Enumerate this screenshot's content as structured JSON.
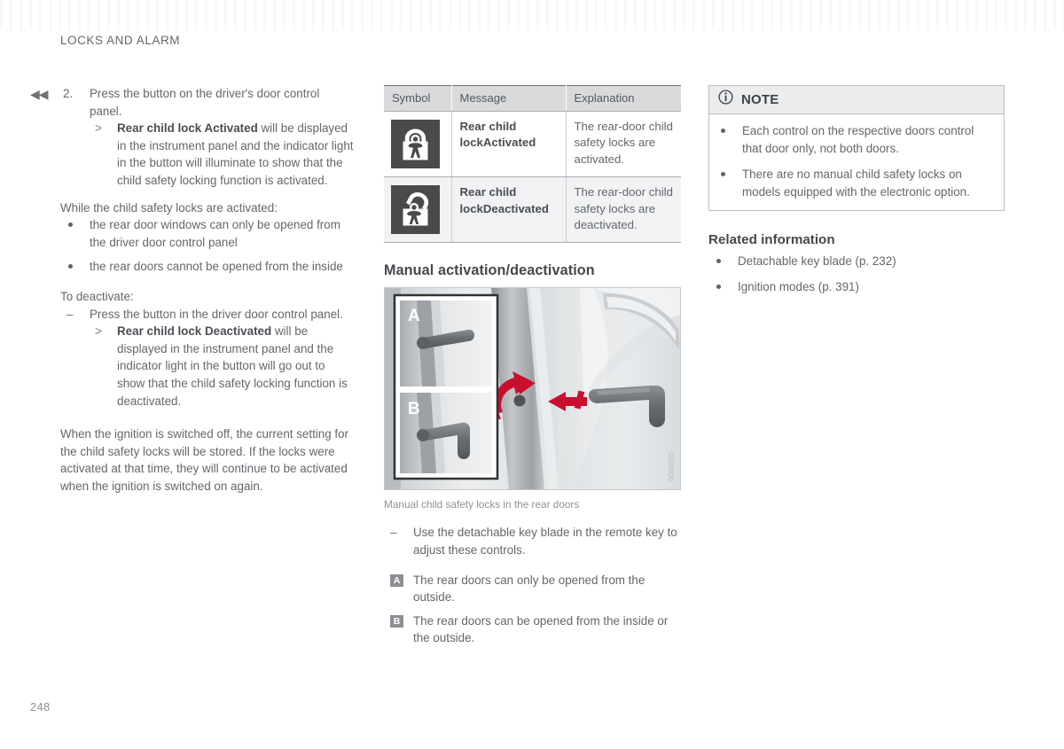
{
  "document": {
    "running_header": "LOCKS AND ALARM",
    "page_number": "248",
    "continuation_marker": "◀◀"
  },
  "left_column": {
    "step": {
      "number": "2.",
      "text": "Press the button on the driver's door control panel.",
      "results": [
        {
          "marker": ">",
          "bold": "Rear child lock Activated",
          "rest": " will be displayed in the instrument panel and the indicator light in the button will illuminate to show that the child safety locking function is activated."
        }
      ]
    },
    "intro_activated": "While the child safety locks are activated:",
    "activated_bullets": [
      "the rear door windows can only be opened from the driver door control panel",
      "the rear doors cannot be opened from the inside"
    ],
    "deactivate_heading": "To deactivate:",
    "deactivate_step": {
      "marker": "–",
      "text": "Press the button in the driver door control panel."
    },
    "deactivate_results": [
      {
        "marker": ">",
        "bold": "Rear child lock Deactivated",
        "rest": " will be displayed in the instrument panel and the indicator light in the button will go out to show that the child safety locking function is deactivated."
      }
    ],
    "closing_paragraph": "When the ignition is switched off, the current setting for the child safety locks will be stored. If the locks were activated at that time, they will continue to be activated when the ignition is switched on again."
  },
  "middle_column": {
    "table": {
      "headers": [
        "Symbol",
        "Message",
        "Explanation"
      ],
      "rows": [
        {
          "symbol_icon": "child-lock-locked-icon",
          "message": "Rear child lockActivated",
          "explanation": "The rear-door child safety locks are activated."
        },
        {
          "symbol_icon": "child-lock-unlocked-icon",
          "message": "Rear child lockDeactivated",
          "explanation": "The rear-door child safety locks are deactivated."
        }
      ]
    },
    "section_heading": "Manual activation/deactivation",
    "figure_caption": "Manual child safety locks in the rear doors",
    "figure_labels": {
      "a": "A",
      "b": "B"
    },
    "figure_watermark": "G030800",
    "instruction": {
      "marker": "–",
      "text": "Use the detachable key blade in the remote key to adjust these controls."
    },
    "callouts": [
      {
        "chip": "A",
        "text": "The rear doors can only be opened from the outside."
      },
      {
        "chip": "B",
        "text": "The rear doors can be opened from the inside or the outside."
      }
    ]
  },
  "right_column": {
    "note": {
      "icon": "info-circle-icon",
      "title": "NOTE",
      "bullets": [
        "Each control on the respective doors control that door only, not both doors.",
        "There are no manual child safety locks on models equipped with the electronic option."
      ]
    },
    "related": {
      "title": "Related information",
      "links": [
        "Detachable key blade (p. 232)",
        "Ignition modes (p. 391)"
      ]
    }
  },
  "colors": {
    "text": "#63676b",
    "heading": "#44484c",
    "table_header_bg": "#d9dadc",
    "icon_bg": "#4a4a4a",
    "arrow_red": "#c8102e",
    "chip_bg": "#8b8f94"
  }
}
